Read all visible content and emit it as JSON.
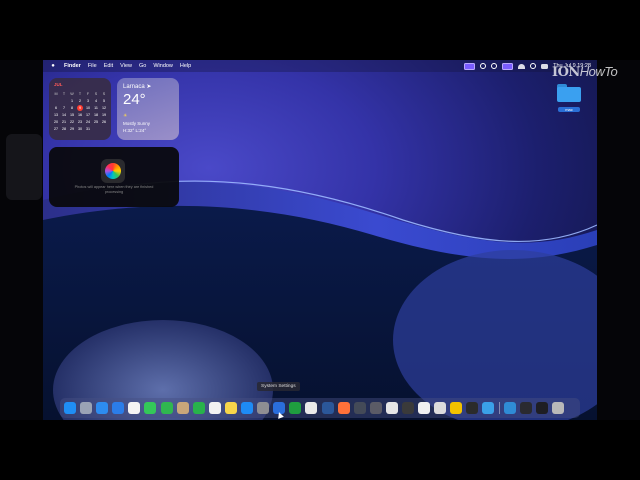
{
  "menubar": {
    "app": "Finder",
    "items": [
      "File",
      "Edit",
      "View",
      "Go",
      "Window",
      "Help"
    ],
    "clock": "Thu Jul 9  19:28"
  },
  "calendar_widget": {
    "month": "JUL",
    "weekdays": [
      "M",
      "T",
      "W",
      "T",
      "F",
      "S",
      "S"
    ],
    "weeks": [
      [
        "",
        "",
        "1",
        "2",
        "3",
        "4",
        "5"
      ],
      [
        "6",
        "7",
        "8",
        "9",
        "10",
        "11",
        "12"
      ],
      [
        "13",
        "14",
        "15",
        "16",
        "17",
        "18",
        "19"
      ],
      [
        "20",
        "21",
        "22",
        "23",
        "24",
        "25",
        "26"
      ],
      [
        "27",
        "28",
        "29",
        "30",
        "31",
        "",
        ""
      ]
    ],
    "today": "9"
  },
  "weather_widget": {
    "city": "Larnaca ➤",
    "temperature": "24°",
    "condition": "Mostly Sunny",
    "high_low": "H:32° L:24°"
  },
  "photos_widget": {
    "message": "Photos will appear here when they are finished processing"
  },
  "desktop_folder": {
    "label": "mac"
  },
  "tooltip": "System Settings",
  "watermark": {
    "main": "ION",
    "suffix": "HowTo"
  },
  "dock": {
    "apps": [
      {
        "name": "finder",
        "color": "#1f8ef5"
      },
      {
        "name": "launchpad",
        "color": "#9aa3b5"
      },
      {
        "name": "safari",
        "color": "#2d8cf0"
      },
      {
        "name": "mail",
        "color": "#2b7de9"
      },
      {
        "name": "photos",
        "color": "#f4f4f4"
      },
      {
        "name": "messages",
        "color": "#34c759"
      },
      {
        "name": "phone",
        "color": "#30b650"
      },
      {
        "name": "contacts",
        "color": "#c9a67a"
      },
      {
        "name": "facetime",
        "color": "#28b24b"
      },
      {
        "name": "reminders",
        "color": "#f2f2f2"
      },
      {
        "name": "notes",
        "color": "#f7d54a"
      },
      {
        "name": "app-store",
        "color": "#1e8bf5"
      },
      {
        "name": "system-settings",
        "color": "#8e8e93"
      },
      {
        "name": "microsoft-store",
        "color": "#2a6edb"
      },
      {
        "name": "xbox",
        "color": "#1f9e3f"
      },
      {
        "name": "chrome",
        "color": "#e9e9e9"
      },
      {
        "name": "word",
        "color": "#2b579a"
      },
      {
        "name": "firefox",
        "color": "#ff7139"
      },
      {
        "name": "davinci-resolve",
        "color": "#444a58"
      },
      {
        "name": "motion",
        "color": "#5b5b66"
      },
      {
        "name": "screenshot",
        "color": "#e6e6e6"
      },
      {
        "name": "activity",
        "color": "#3a3a3a"
      },
      {
        "name": "roblox",
        "color": "#f0f0f0"
      },
      {
        "name": "epic",
        "color": "#dcdcdc"
      },
      {
        "name": "keynote",
        "color": "#f2c200"
      },
      {
        "name": "terminal",
        "color": "#2b2b2b"
      },
      {
        "name": "quicktime",
        "color": "#3aa0e8"
      }
    ],
    "folders": [
      {
        "name": "downloads",
        "color": "#2f8bd6"
      },
      {
        "name": "desktop-thumb-1",
        "color": "#2a2a30"
      },
      {
        "name": "desktop-thumb-2",
        "color": "#1e1e24"
      },
      {
        "name": "trash",
        "color": "#b9b9b9"
      }
    ]
  }
}
